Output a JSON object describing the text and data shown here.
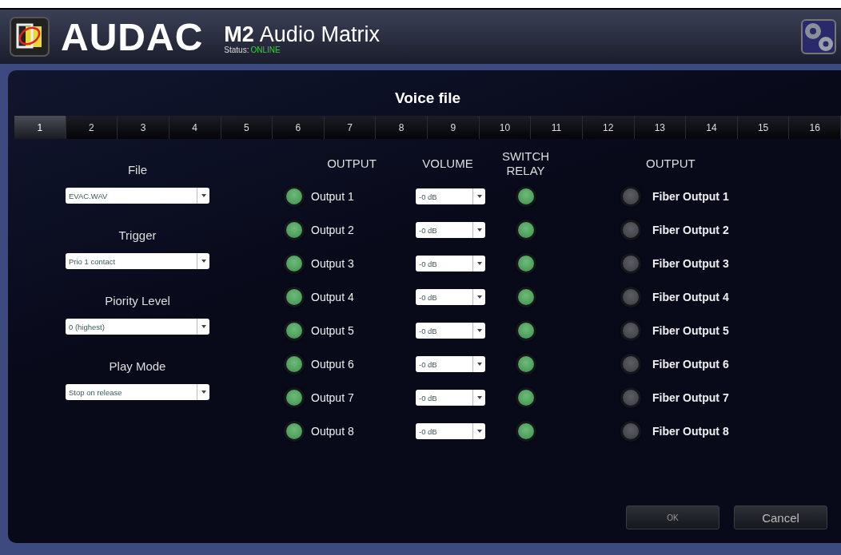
{
  "header": {
    "brand": "AUDAC",
    "model": "M2",
    "product": "Audio Matrix",
    "status_label": "Status:",
    "status_value": "ONLINE"
  },
  "title": "Voice file",
  "tabs": [
    {
      "label": "1",
      "selected": true
    },
    {
      "label": "2",
      "selected": false
    },
    {
      "label": "3",
      "selected": false
    },
    {
      "label": "4",
      "selected": false
    },
    {
      "label": "5",
      "selected": false
    },
    {
      "label": "6",
      "selected": false
    },
    {
      "label": "7",
      "selected": false
    },
    {
      "label": "8",
      "selected": false
    },
    {
      "label": "9",
      "selected": false
    },
    {
      "label": "10",
      "selected": false
    },
    {
      "label": "11",
      "selected": false
    },
    {
      "label": "12",
      "selected": false
    },
    {
      "label": "13",
      "selected": false
    },
    {
      "label": "14",
      "selected": false
    },
    {
      "label": "15",
      "selected": false
    },
    {
      "label": "16",
      "selected": false
    }
  ],
  "settings": [
    {
      "label": "File",
      "value": "EVAC.WAV"
    },
    {
      "label": "Trigger",
      "value": "Prio 1 contact"
    },
    {
      "label": "Piority Level",
      "value": "0 (highest)"
    },
    {
      "label": "Play Mode",
      "value": "Stop on release"
    }
  ],
  "columns": [
    "OUTPUT",
    "VOLUME",
    "SWITCH RELAY",
    "OUTPUT"
  ],
  "outputs": [
    {
      "name": "Output 1",
      "on": true,
      "volume": "-0 dB",
      "relay": true,
      "fiber_name": "Fiber Output 1",
      "fiber_on": false
    },
    {
      "name": "Output 2",
      "on": true,
      "volume": "-0 dB",
      "relay": true,
      "fiber_name": "Fiber Output 2",
      "fiber_on": false
    },
    {
      "name": "Output 3",
      "on": true,
      "volume": "-0 dB",
      "relay": true,
      "fiber_name": "Fiber Output 3",
      "fiber_on": false
    },
    {
      "name": "Output 4",
      "on": true,
      "volume": "-0 dB",
      "relay": true,
      "fiber_name": "Fiber Output 4",
      "fiber_on": false
    },
    {
      "name": "Output 5",
      "on": true,
      "volume": "-0 dB",
      "relay": true,
      "fiber_name": "Fiber Output 5",
      "fiber_on": false
    },
    {
      "name": "Output 6",
      "on": true,
      "volume": "-0 dB",
      "relay": true,
      "fiber_name": "Fiber Output 6",
      "fiber_on": false
    },
    {
      "name": "Output 7",
      "on": true,
      "volume": "-0 dB",
      "relay": true,
      "fiber_name": "Fiber Output 7",
      "fiber_on": false
    },
    {
      "name": "Output 8",
      "on": true,
      "volume": "-0 dB",
      "relay": true,
      "fiber_name": "Fiber Output 8",
      "fiber_on": false
    }
  ],
  "buttons": [
    "OK",
    "Cancel"
  ]
}
